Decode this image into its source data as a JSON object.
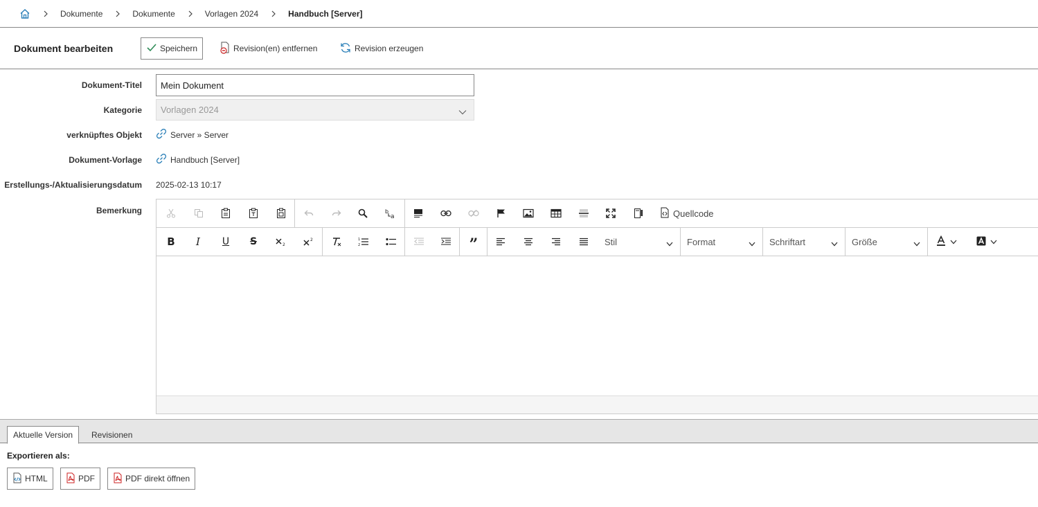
{
  "breadcrumb": {
    "items": [
      "Dokumente",
      "Dokumente",
      "Vorlagen 2024"
    ],
    "current": "Handbuch [Server]"
  },
  "header": {
    "title": "Dokument bearbeiten",
    "save_label": "Speichern",
    "remove_revisions_label": "Revision(en) entfernen",
    "create_revision_label": "Revision erzeugen"
  },
  "form": {
    "title_label": "Dokument-Titel",
    "title_value": "Mein Dokument",
    "category_label": "Kategorie",
    "category_value": "Vorlagen 2024",
    "linked_object_label": "verknüpftes Objekt",
    "linked_object_value": "Server » Server",
    "template_label": "Dokument-Vorlage",
    "template_value": "Handbuch [Server]",
    "date_label": "Erstellungs-/Aktualisierungsdatum",
    "date_value": "2025-02-13 10:17",
    "remark_label": "Bemerkung"
  },
  "editor": {
    "source_label": "Quellcode",
    "style_dropdown": "Stil",
    "format_dropdown": "Format",
    "font_dropdown": "Schriftart",
    "size_dropdown": "Größe"
  },
  "bottom": {
    "tabs": [
      "Aktuelle Version",
      "Revisionen"
    ],
    "export_label": "Exportieren als:",
    "export_html": "HTML",
    "export_pdf": "PDF",
    "export_pdf_open": "PDF direkt öffnen"
  },
  "colors": {
    "link_icon": "#2a7fb8",
    "check": "#2e8b57",
    "pdf_red": "#cc2222",
    "border": "#888888"
  }
}
